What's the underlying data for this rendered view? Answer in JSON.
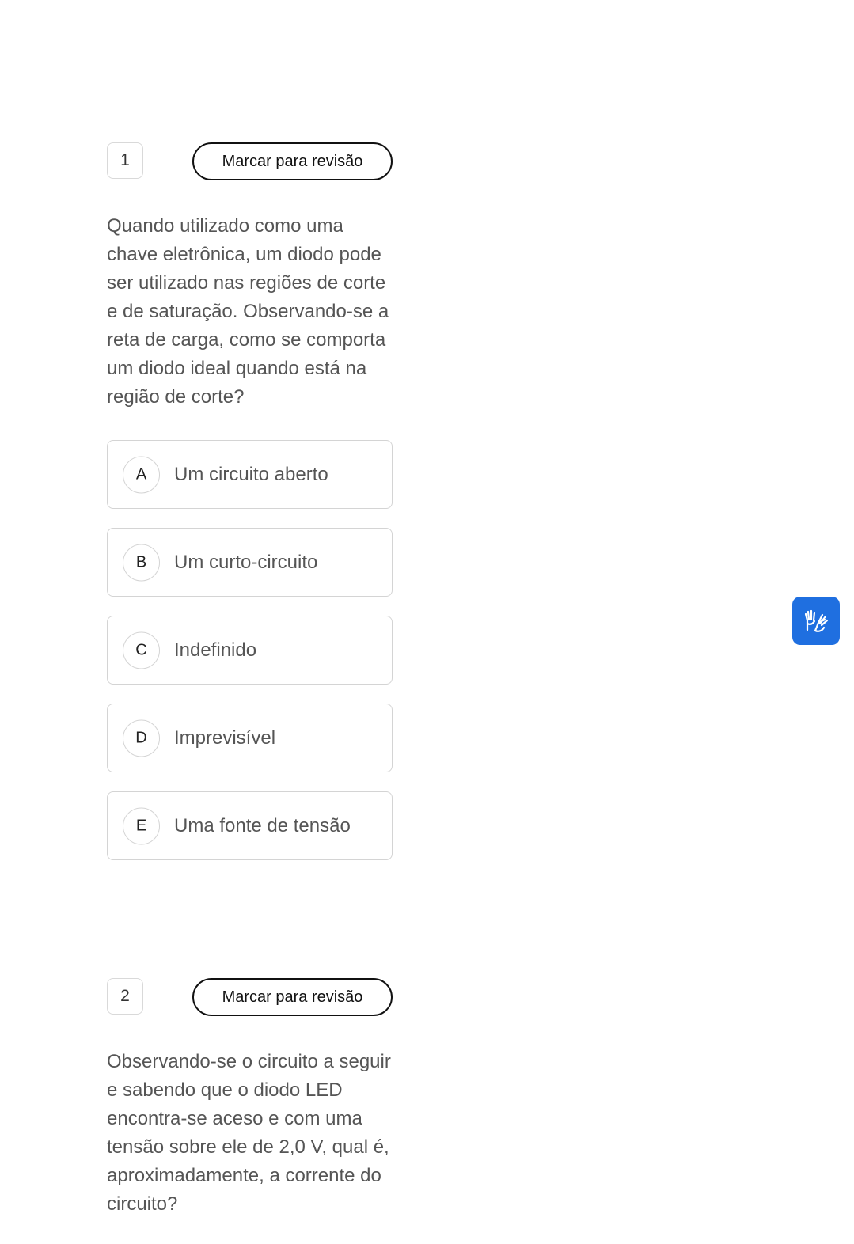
{
  "questions": [
    {
      "number": "1",
      "review_label": "Marcar para revisão",
      "text": "Quando utilizado como uma chave eletrônica, um diodo pode ser utilizado nas regiões de corte e de saturação. Observando-se a reta de carga, como se comporta um diodo ideal quando está na região de corte?",
      "options": [
        {
          "letter": "A",
          "text": "Um circuito aberto"
        },
        {
          "letter": "B",
          "text": "Um curto-circuito"
        },
        {
          "letter": "C",
          "text": "Indefinido"
        },
        {
          "letter": "D",
          "text": "Imprevisível"
        },
        {
          "letter": "E",
          "text": "Uma fonte de tensão"
        }
      ]
    },
    {
      "number": "2",
      "review_label": "Marcar para revisão",
      "text": "Observando-se o circuito a seguir e sabendo que o diodo LED encontra-se aceso e com uma tensão sobre ele de 2,0 V, qual é, aproximadamente, a corrente do circuito?"
    }
  ],
  "accessibility_widget": {
    "icon": "sign-language-hands-icon",
    "color": "#1f6fe0"
  }
}
